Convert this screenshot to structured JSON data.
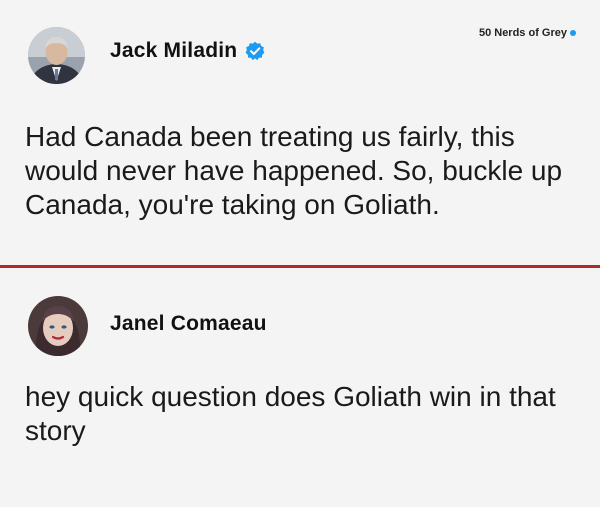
{
  "watermark": {
    "text": "50 Nerds of Grey",
    "dot_color": "#1d9bf0"
  },
  "posts": [
    {
      "author": "Jack Miladin",
      "verified": true,
      "verified_icon": "verified-badge-icon",
      "text": "Had Canada been treating us fairly, this would never have happened. So, buckle up Canada, you're taking on Goliath."
    },
    {
      "author": "Janel Comaeau",
      "verified": false,
      "text": "hey quick question does Goliath win in that story"
    }
  ],
  "colors": {
    "background": "#f4f4f4",
    "divider": "#b22a27",
    "verified_badge": "#1d9bf0"
  }
}
